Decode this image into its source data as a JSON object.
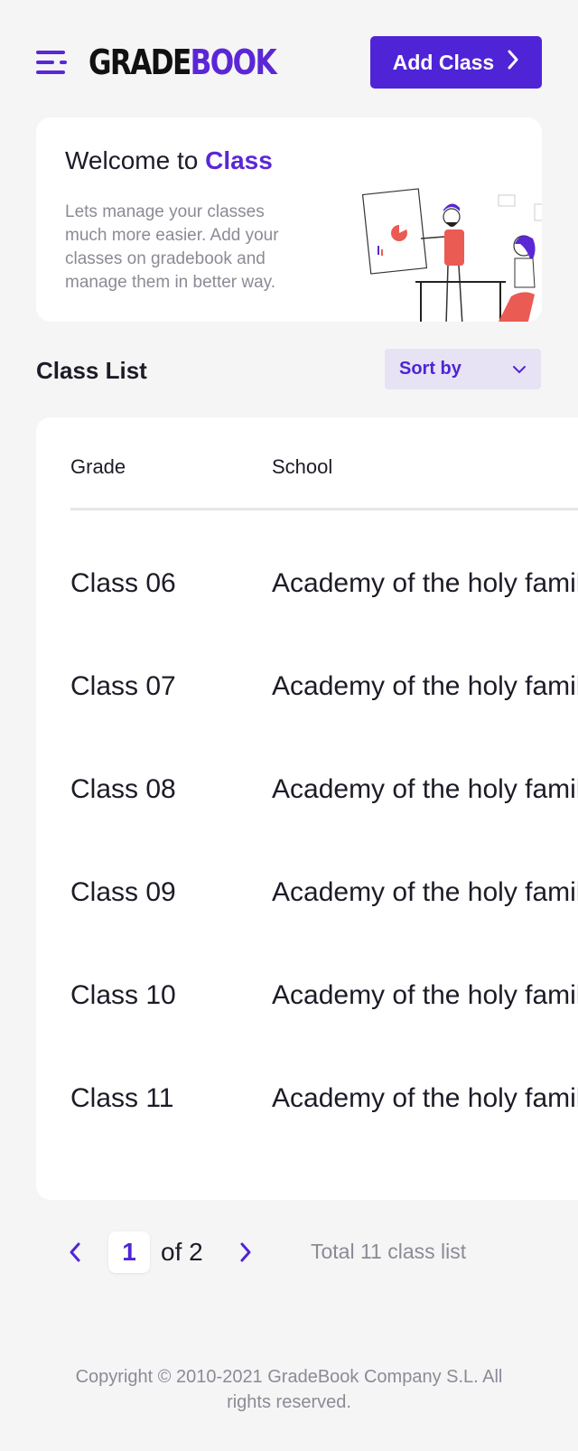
{
  "header": {
    "logo_part1": "GRADE",
    "logo_part2": "BOOK",
    "add_button_label": "Add Class"
  },
  "welcome": {
    "title_prefix": "Welcome to",
    "title_accent": "Class",
    "description": "Lets manage your classes much more easier. Add your classes on gradebook and manage them in better way."
  },
  "class_list": {
    "title": "Class List",
    "sort_label": "Sort by",
    "columns": [
      "Grade",
      "School"
    ],
    "rows": [
      {
        "grade": "Class 06",
        "school": "Academy of the holy family"
      },
      {
        "grade": "Class 07",
        "school": "Academy of the holy family"
      },
      {
        "grade": "Class 08",
        "school": "Academy of the holy family"
      },
      {
        "grade": "Class 09",
        "school": "Academy of the holy family"
      },
      {
        "grade": "Class 10",
        "school": "Academy of the holy family"
      },
      {
        "grade": "Class 11",
        "school": "Academy of the holy family"
      }
    ]
  },
  "pagination": {
    "current_page": "1",
    "of_text": "of 2",
    "total_text": "Total 11 class list"
  },
  "footer": {
    "copyright": "Copyright © 2010-2021 GradeBook Company S.L. All rights reserved."
  },
  "colors": {
    "accent": "#4f24d6",
    "background": "#f5f5f6",
    "muted_text": "#8b8b95"
  }
}
